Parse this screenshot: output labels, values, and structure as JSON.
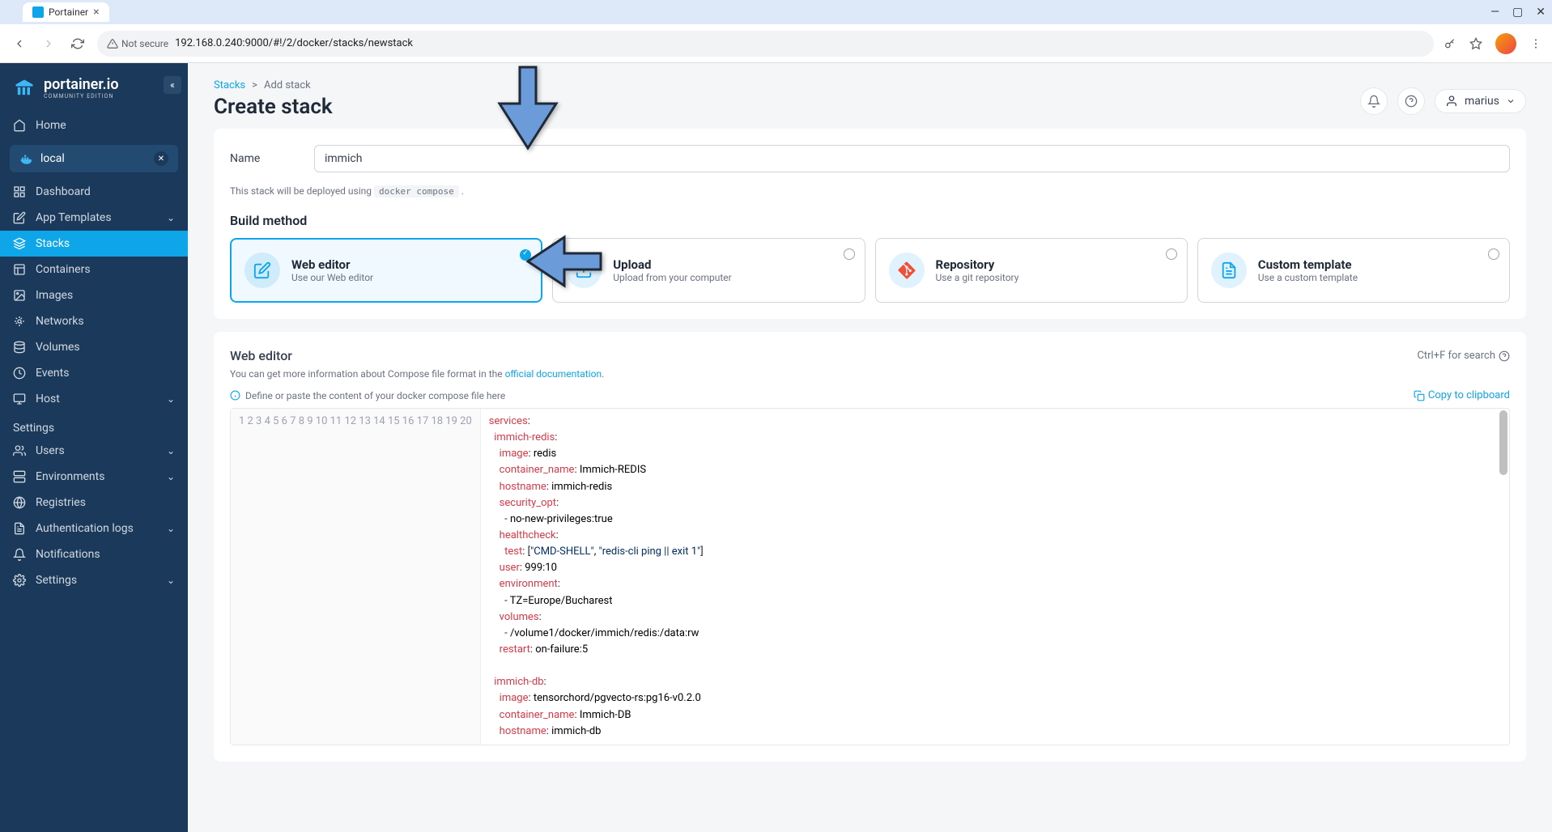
{
  "browser": {
    "tab_title": "Portainer",
    "url": "192.168.0.240:9000/#!/2/docker/stacks/newstack",
    "not_secure": "Not secure"
  },
  "sidebar": {
    "logo": "portainer.io",
    "logo_sub": "COMMUNITY EDITION",
    "home": "Home",
    "env": "local",
    "items": [
      {
        "icon": "dashboard",
        "label": "Dashboard"
      },
      {
        "icon": "templates",
        "label": "App Templates",
        "chevron": true
      },
      {
        "icon": "stacks",
        "label": "Stacks",
        "active": true
      },
      {
        "icon": "containers",
        "label": "Containers"
      },
      {
        "icon": "images",
        "label": "Images"
      },
      {
        "icon": "networks",
        "label": "Networks"
      },
      {
        "icon": "volumes",
        "label": "Volumes"
      },
      {
        "icon": "events",
        "label": "Events"
      },
      {
        "icon": "host",
        "label": "Host",
        "chevron": true
      }
    ],
    "settings_label": "Settings",
    "settings": [
      {
        "icon": "users",
        "label": "Users",
        "chevron": true
      },
      {
        "icon": "env",
        "label": "Environments",
        "chevron": true
      },
      {
        "icon": "reg",
        "label": "Registries"
      },
      {
        "icon": "auth",
        "label": "Authentication logs",
        "chevron": true
      },
      {
        "icon": "notif",
        "label": "Notifications"
      },
      {
        "icon": "settings",
        "label": "Settings",
        "chevron": true
      }
    ]
  },
  "header": {
    "crumb1": "Stacks",
    "crumb2": "Add stack",
    "title": "Create stack",
    "username": "marius"
  },
  "form": {
    "name_label": "Name",
    "name_value": "immich",
    "deploy_hint_pre": "This stack will be deployed using ",
    "deploy_hint_code": "docker compose",
    "build_label": "Build method",
    "methods": [
      {
        "title": "Web editor",
        "desc": "Use our Web editor",
        "selected": true,
        "icon": "edit"
      },
      {
        "title": "Upload",
        "desc": "Upload from your computer",
        "icon": "upload"
      },
      {
        "title": "Repository",
        "desc": "Use a git repository",
        "icon": "git"
      },
      {
        "title": "Custom template",
        "desc": "Use a custom template",
        "icon": "template"
      }
    ]
  },
  "editor": {
    "title": "Web editor",
    "search_hint": "Ctrl+F for search",
    "info_pre": "You can get more information about Compose file format in the ",
    "info_link": "official documentation",
    "placeholder": "Define or paste the content of your docker compose file here",
    "copy": "Copy to clipboard",
    "lines": [
      "services:",
      "  immich-redis:",
      "    image: redis",
      "    container_name: Immich-REDIS",
      "    hostname: immich-redis",
      "    security_opt:",
      "      - no-new-privileges:true",
      "    healthcheck:",
      "      test: [\"CMD-SHELL\", \"redis-cli ping || exit 1\"]",
      "    user: 999:10",
      "    environment:",
      "      - TZ=Europe/Bucharest",
      "    volumes:",
      "      - /volume1/docker/immich/redis:/data:rw",
      "    restart: on-failure:5",
      "",
      "  immich-db:",
      "    image: tensorchord/pgvecto-rs:pg16-v0.2.0",
      "    container_name: Immich-DB",
      "    hostname: immich-db"
    ]
  }
}
